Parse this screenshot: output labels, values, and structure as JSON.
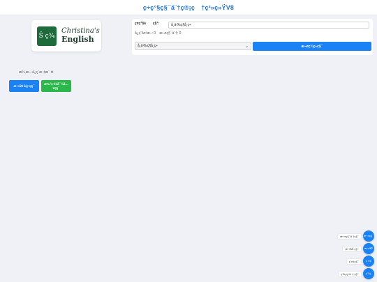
{
  "header": {
    "title": "ç÷ç°§ç§¯ä¨†ç®¡ç　†ç³»ç»ŸV8"
  },
  "logo": {
    "badge": "Š ç¾",
    "line1": "Christina's",
    "line2": "English"
  },
  "search": {
    "label": "ç¤ç°§ä　　ç§°:",
    "value": "å¸ä¹‰ç§å¸ç÷",
    "stats": [
      "å¿ç¨å¤²æ–: 0",
      "æ¬¤ç§¯ä¨†: 0"
    ]
  },
  "filter": {
    "selected": "å¸ä¹‰ç§å¸ç÷"
  },
  "go_button": {
    "label": "æ¬¤ç­¾ç÷ç§¯"
  },
  "sidebar": {
    "label": "æ¼‚æ—å¿ç¨æ ‡æ¨  ⚙",
    "buttons": [
      {
        "label": "æ·»åŠ å­¦ç¨ç§¯"
      },
      {
        "label": "æ‰¹ç¨é‡å¯¼å…¥ç§¯"
      }
    ]
  },
  "fabs": [
    {
      "label": "æ¬¤ç§¯ä¨†ç§¯",
      "icon": "æ¬¤ç§¯"
    },
    {
      "label": "æ·»åŠ ç§¯",
      "icon": "æ·»åŠ "
    },
    {
      "label": "ç¨é‡ç§¯",
      "icon": "ç¨é‡"
    },
    {
      "label": "ç¨å¿ç¨æ ‡ ç§¯",
      "icon": "ç¨å¿"
    }
  ],
  "colors": {
    "accent": "#1a82f5",
    "success": "#2bb84b",
    "title": "#1e73d8",
    "logo_bg": "#1d6b3a"
  }
}
